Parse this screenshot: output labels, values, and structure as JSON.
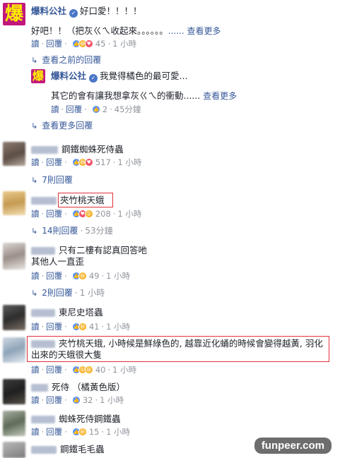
{
  "labels": {
    "reply": "讀",
    "reply2": "回覆",
    "dot": "·"
  },
  "top": {
    "author": "爆料公社",
    "avatar_char": "爆",
    "text": "好口愛！！！！",
    "reply1": {
      "text": "好吧！！（把灰ㄍㄟ收起來。。。。。。",
      "see_more": "...... 查看更多",
      "count": "45",
      "time": "1 小時"
    },
    "previous_link": "查看之前的回覆",
    "reply2": {
      "author": "爆料公社",
      "avatar_char": "爆",
      "text": "我覺得橘色的最可愛...",
      "text2": "其它的會有讓我想拿灰ㄍㄟ的衝動......",
      "see_more": "查看更多",
      "count": "2",
      "time": "45分鐘"
    },
    "more_link": "查看更多回覆"
  },
  "comments": [
    {
      "text": "鋼鐵蜘蛛死侍蟲",
      "count": "517",
      "time": "1 小時",
      "replies": "7則回覆",
      "replies_time": ""
    },
    {
      "text": "夾竹桃天蛾",
      "count": "208",
      "time": "1 小時",
      "replies": "14則回覆",
      "replies_time": "53分鐘"
    },
    {
      "text": "只有二樓有認真回答吔",
      "text2": "其他人一直歪",
      "count": "49",
      "time": "1 小時",
      "replies": "2則回覆",
      "replies_time": "1 小時"
    },
    {
      "text": "東尼史塔蟲",
      "count": "41",
      "time": "1 小時"
    },
    {
      "text": "夾竹桃天蛾, 小時候是鮮綠色的, 越靠近化蛹的時候會變得越黃, 羽化",
      "text2": "出來的天蛾很大隻",
      "count": "40",
      "time": "1 小時"
    },
    {
      "text": "死侍 （橘黃色版）",
      "count": "32",
      "time": "1 小時"
    },
    {
      "text": "蜘蛛死侍鋼鐵蟲",
      "count": "15",
      "time": "1 小時"
    },
    {
      "text": "鋼鐵毛毛蟲"
    }
  ],
  "watermark": "funpeer.com",
  "colors": {
    "link": "#365899",
    "meta": "#90949c",
    "highlight": "#e0313b",
    "page_avatar": "#c2187c",
    "page_avatar_text": "#fff000"
  }
}
